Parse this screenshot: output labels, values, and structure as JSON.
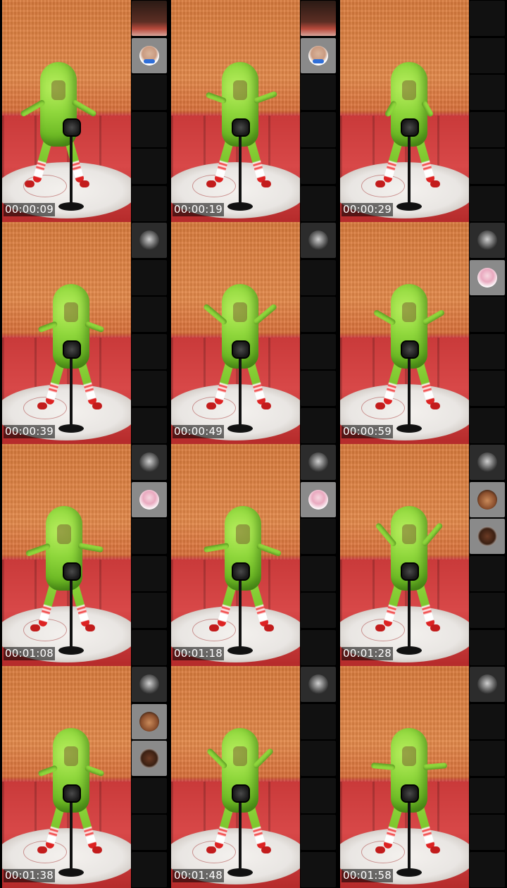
{
  "frames": [
    {
      "timestamp": "00:00:09",
      "pose": "wide-arms-low"
    },
    {
      "timestamp": "00:00:19",
      "pose": "arms-out-wave"
    },
    {
      "timestamp": "00:00:29",
      "pose": "arms-down-close"
    },
    {
      "timestamp": "00:00:39",
      "pose": "arms-down"
    },
    {
      "timestamp": "00:00:49",
      "pose": "arms-raised-wide"
    },
    {
      "timestamp": "00:00:59",
      "pose": "arms-raised"
    },
    {
      "timestamp": "00:01:08",
      "pose": "lean-left"
    },
    {
      "timestamp": "00:01:18",
      "pose": "lean-right"
    },
    {
      "timestamp": "00:01:28",
      "pose": "arms-up-wide"
    },
    {
      "timestamp": "00:01:38",
      "pose": "arms-down"
    },
    {
      "timestamp": "00:01:48",
      "pose": "arms-up"
    },
    {
      "timestamp": "00:01:58",
      "pose": "arms-mid"
    }
  ],
  "strips": [
    {
      "slots": [
        "top-face",
        "blue-avatar",
        "empty",
        "empty",
        "empty",
        "empty"
      ]
    },
    {
      "slots": [
        "top-face",
        "blue-avatar",
        "empty",
        "empty",
        "empty",
        "empty"
      ]
    },
    {
      "slots": [
        "empty",
        "empty",
        "empty",
        "empty",
        "empty",
        "empty"
      ]
    },
    {
      "slots": [
        "dark-avatar",
        "empty",
        "empty",
        "empty",
        "empty",
        "empty"
      ]
    },
    {
      "slots": [
        "dark-avatar",
        "empty",
        "empty",
        "empty",
        "empty",
        "empty"
      ]
    },
    {
      "slots": [
        "dark-avatar",
        "pink-avatar",
        "empty",
        "empty",
        "empty",
        "empty"
      ]
    },
    {
      "slots": [
        "dark-avatar",
        "pink-avatar",
        "empty",
        "empty",
        "empty",
        "empty"
      ]
    },
    {
      "slots": [
        "dark-avatar",
        "pink-avatar",
        "empty",
        "empty",
        "empty",
        "empty"
      ]
    },
    {
      "slots": [
        "dark-avatar",
        "skin-avatar",
        "face-avatar",
        "empty",
        "empty",
        "empty"
      ]
    },
    {
      "slots": [
        "dark-avatar",
        "skin-avatar",
        "face-avatar",
        "empty",
        "empty",
        "empty"
      ]
    },
    {
      "slots": [
        "dark-avatar",
        "empty",
        "empty",
        "empty",
        "empty",
        "empty"
      ]
    },
    {
      "slots": [
        "dark-avatar",
        "empty",
        "empty",
        "empty",
        "empty",
        "empty"
      ]
    }
  ],
  "colors": {
    "background": "#000000",
    "wall": "#d97b3c",
    "panel": "#c93a3a",
    "pickle": "#8fd73c",
    "shoe": "#c21c1c"
  }
}
